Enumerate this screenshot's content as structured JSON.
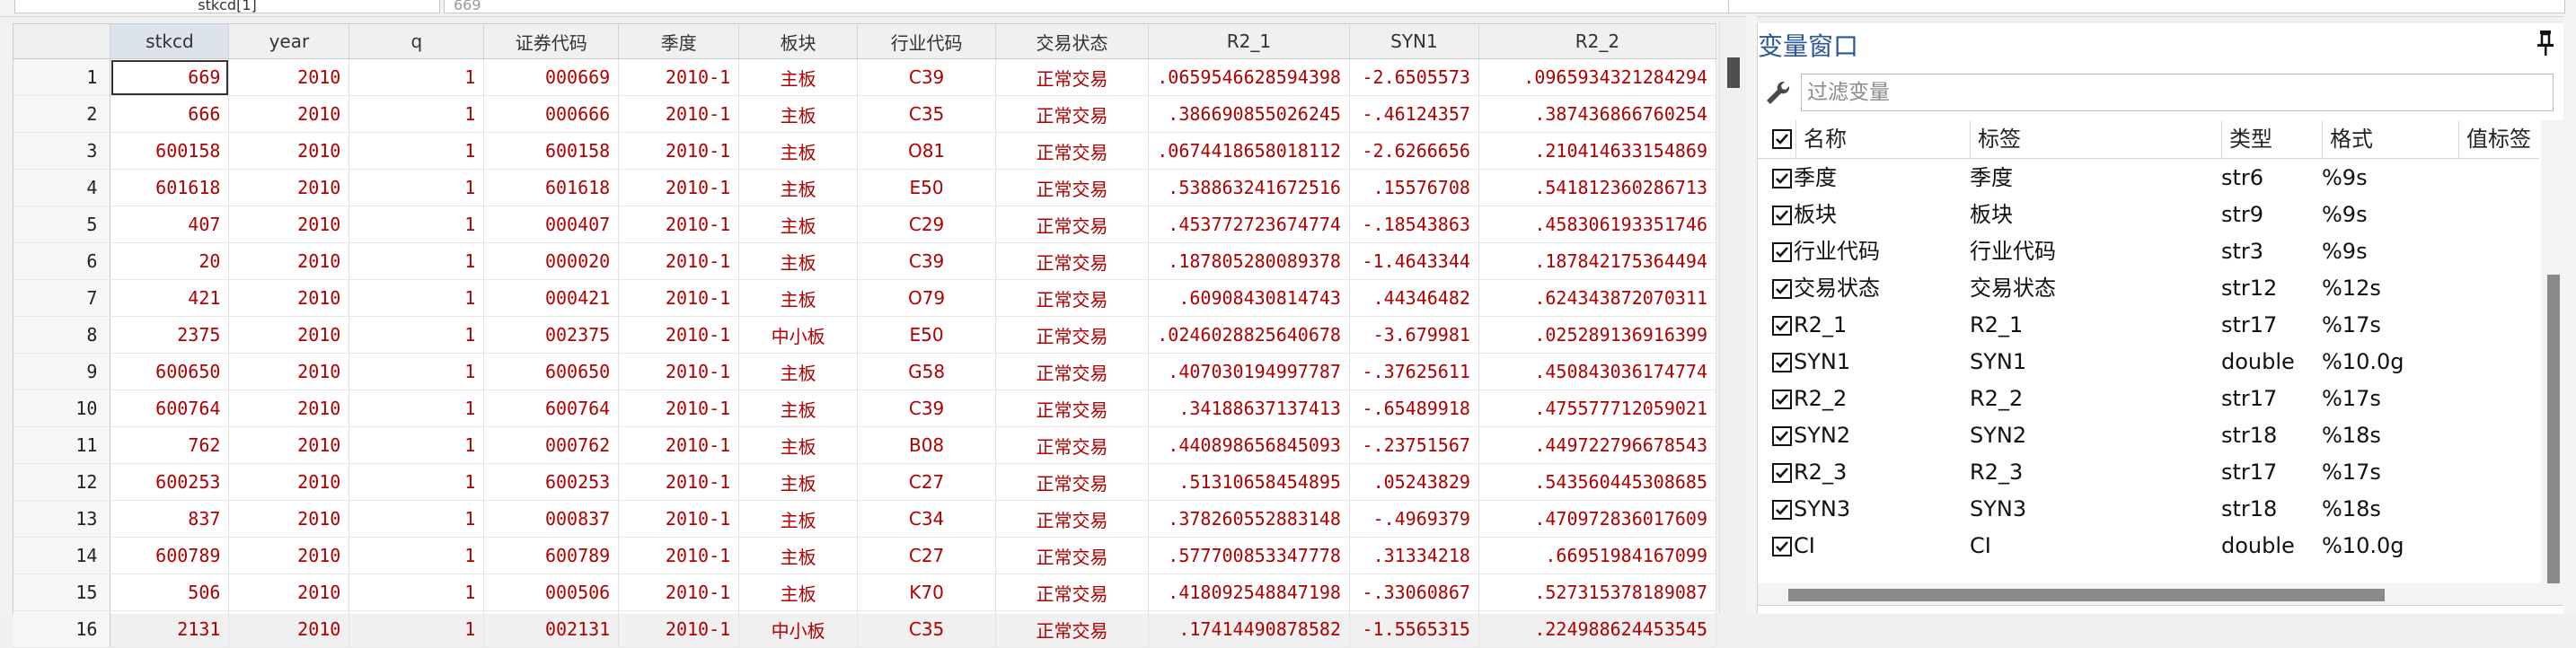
{
  "topbar": {
    "varname_value": "stkcd[1]",
    "cell_value": "669"
  },
  "grid": {
    "columns": [
      "stkcd",
      "year",
      "q",
      "证券代码",
      "季度",
      "板块",
      "行业代码",
      "交易状态",
      "R2_1",
      "SYN1",
      "R2_2"
    ],
    "rows": [
      [
        "1",
        "669",
        "2010",
        "1",
        "000669",
        "2010-1",
        "主板",
        "C39",
        "正常交易",
        ".0659546628594398",
        "-2.6505573",
        ".0965934321284294"
      ],
      [
        "2",
        "666",
        "2010",
        "1",
        "000666",
        "2010-1",
        "主板",
        "C35",
        "正常交易",
        ".386690855026245",
        "-.46124357",
        ".387436866760254"
      ],
      [
        "3",
        "600158",
        "2010",
        "1",
        "600158",
        "2010-1",
        "主板",
        "O81",
        "正常交易",
        ".0674418658018112",
        "-2.6266656",
        ".210414633154869"
      ],
      [
        "4",
        "601618",
        "2010",
        "1",
        "601618",
        "2010-1",
        "主板",
        "E50",
        "正常交易",
        ".538863241672516",
        ".15576708",
        ".541812360286713"
      ],
      [
        "5",
        "407",
        "2010",
        "1",
        "000407",
        "2010-1",
        "主板",
        "C29",
        "正常交易",
        ".453772723674774",
        "-.18543863",
        ".458306193351746"
      ],
      [
        "6",
        "20",
        "2010",
        "1",
        "000020",
        "2010-1",
        "主板",
        "C39",
        "正常交易",
        ".187805280089378",
        "-1.4643344",
        ".187842175364494"
      ],
      [
        "7",
        "421",
        "2010",
        "1",
        "000421",
        "2010-1",
        "主板",
        "O79",
        "正常交易",
        ".60908430814743",
        ".44346482",
        ".624343872070311"
      ],
      [
        "8",
        "2375",
        "2010",
        "1",
        "002375",
        "2010-1",
        "中小板",
        "E50",
        "正常交易",
        ".0246028825640678",
        "-3.679981",
        ".025289136916399"
      ],
      [
        "9",
        "600650",
        "2010",
        "1",
        "600650",
        "2010-1",
        "主板",
        "G58",
        "正常交易",
        ".407030194997787",
        "-.37625611",
        ".450843036174774"
      ],
      [
        "10",
        "600764",
        "2010",
        "1",
        "600764",
        "2010-1",
        "主板",
        "C39",
        "正常交易",
        ".34188637137413",
        "-.65489918",
        ".475577712059021"
      ],
      [
        "11",
        "762",
        "2010",
        "1",
        "000762",
        "2010-1",
        "主板",
        "B08",
        "正常交易",
        ".440898656845093",
        "-.23751567",
        ".449722796678543"
      ],
      [
        "12",
        "600253",
        "2010",
        "1",
        "600253",
        "2010-1",
        "主板",
        "C27",
        "正常交易",
        ".51310658454895",
        ".05243829",
        ".543560445308685"
      ],
      [
        "13",
        "837",
        "2010",
        "1",
        "000837",
        "2010-1",
        "主板",
        "C34",
        "正常交易",
        ".378260552883148",
        "-.4969379",
        ".470972836017609"
      ],
      [
        "14",
        "600789",
        "2010",
        "1",
        "600789",
        "2010-1",
        "主板",
        "C27",
        "正常交易",
        ".577700853347778",
        ".31334218",
        ".66951984167099"
      ],
      [
        "15",
        "506",
        "2010",
        "1",
        "000506",
        "2010-1",
        "主板",
        "K70",
        "正常交易",
        ".418092548847198",
        "-.33060867",
        ".527315378189087"
      ],
      [
        "16",
        "2131",
        "2010",
        "1",
        "002131",
        "2010-1",
        "中小板",
        "C35",
        "正常交易",
        ".17414490878582",
        "-1.5565315",
        ".224988624453545"
      ]
    ]
  },
  "var_panel": {
    "title": "变量窗口",
    "filter_placeholder": "过滤变量",
    "headers": {
      "name": "名称",
      "label": "标签",
      "type": "类型",
      "format": "格式",
      "value_label": "值标签"
    },
    "rows": [
      {
        "name": "季度",
        "label": "季度",
        "type": "str6",
        "format": "%9s"
      },
      {
        "name": "板块",
        "label": "板块",
        "type": "str9",
        "format": "%9s"
      },
      {
        "name": "行业代码",
        "label": "行业代码",
        "type": "str3",
        "format": "%9s"
      },
      {
        "name": "交易状态",
        "label": "交易状态",
        "type": "str12",
        "format": "%12s"
      },
      {
        "name": "R2_1",
        "label": "R2_1",
        "type": "str17",
        "format": "%17s"
      },
      {
        "name": "SYN1",
        "label": "SYN1",
        "type": "double",
        "format": "%10.0g"
      },
      {
        "name": "R2_2",
        "label": "R2_2",
        "type": "str17",
        "format": "%17s"
      },
      {
        "name": "SYN2",
        "label": "SYN2",
        "type": "str18",
        "format": "%18s"
      },
      {
        "name": "R2_3",
        "label": "R2_3",
        "type": "str17",
        "format": "%17s"
      },
      {
        "name": "SYN3",
        "label": "SYN3",
        "type": "str18",
        "format": "%18s"
      },
      {
        "name": "CI",
        "label": "CI",
        "type": "double",
        "format": "%10.0g"
      }
    ]
  },
  "colors": {
    "data_red": "#b00000",
    "title_blue": "#2b579a",
    "header_bg": "#eef0f2"
  },
  "icons": {
    "filter": "wrench-icon",
    "pin": "pin-icon",
    "check": "checkbox-checked-icon"
  }
}
